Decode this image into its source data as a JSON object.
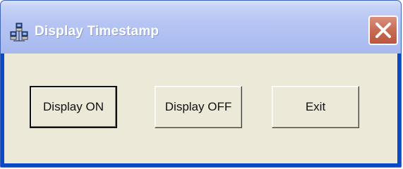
{
  "window": {
    "title": "Display Timestamp",
    "icon": "network-computers-icon",
    "close_icon": "close-icon"
  },
  "buttons": {
    "display_on": "Display ON",
    "display_off": "Display OFF",
    "exit": "Exit"
  },
  "colors": {
    "titlebar": "#aebff1",
    "close_button": "#c86b55",
    "client_background": "#ece9d8",
    "border": "#0a4ac6"
  }
}
